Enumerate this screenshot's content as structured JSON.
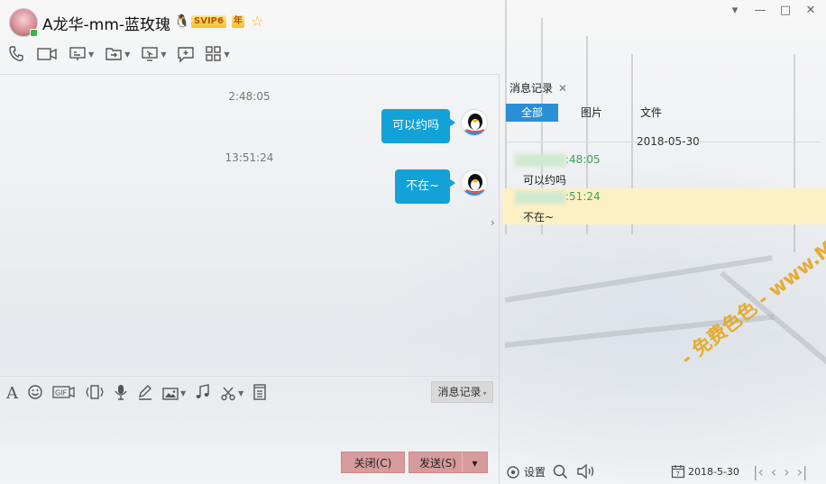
{
  "header": {
    "contact_name": "A龙华-mm-蓝玫瑰",
    "vip_label": "SVIP6",
    "year_label": "年"
  },
  "window_controls": [
    "▾",
    "—",
    "□",
    "✕"
  ],
  "toolbar_icons": [
    "phone-icon",
    "video-icon",
    "screen-share-icon",
    "file-transfer-icon",
    "remote-desktop-icon",
    "add-app-icon",
    "apps-grid-icon"
  ],
  "chat": {
    "messages": [
      {
        "time": "2:48:05",
        "text": "可以约吗"
      },
      {
        "time": "13:51:24",
        "text": "不在~"
      }
    ]
  },
  "input_toolbar": {
    "icons": [
      "font-icon",
      "emoji-icon",
      "gif-icon",
      "shake-icon",
      "voice-icon",
      "handwriting-icon",
      "image-icon",
      "music-icon",
      "screenshot-icon",
      "history-doc-icon"
    ],
    "history_button": "消息记录"
  },
  "buttons": {
    "close": "关闭(C)",
    "send": "发送(S)"
  },
  "history_panel": {
    "tab_label": "消息记录",
    "filters": [
      "全部",
      "图片",
      "文件"
    ],
    "active_filter": "全部",
    "date": "2018-05-30",
    "items": [
      {
        "time_suffix": ":48:05",
        "text": "可以约吗"
      },
      {
        "time_suffix": ":51:24",
        "text": "不在~"
      }
    ],
    "settings_label": "设置",
    "date_picker": "2018-5-30"
  },
  "watermark": "- 免费色色 - www.MFsese.com",
  "colors": {
    "bubble": "#12a2d8",
    "active_filter": "#2b8fd6",
    "button": "#d79b9b",
    "highlight_row": "#fdf0c5",
    "time_green": "#3aa35a",
    "watermark": "#e7a61d"
  }
}
